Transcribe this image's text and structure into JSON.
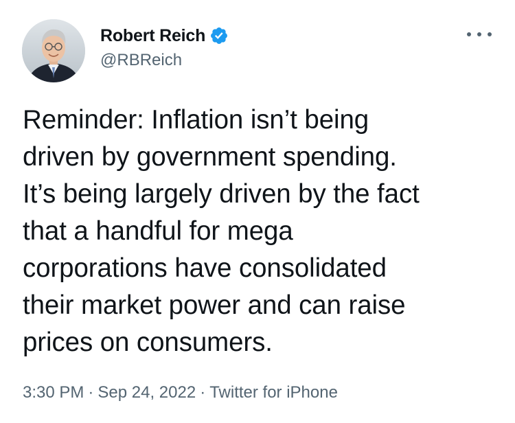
{
  "author": {
    "display_name": "Robert Reich",
    "handle": "@RBReich",
    "verified": true,
    "verified_color": "#1d9bf0"
  },
  "tweet": {
    "text_lines": [
      "Reminder: Inflation isn’t being",
      "driven by government spending.",
      "It’s being largely driven by the fact",
      "that a handful for mega",
      "corporations have consolidated",
      "their market power and can raise",
      "prices on consumers."
    ]
  },
  "meta": {
    "time": "3:30 PM",
    "separator": "·",
    "date": "Sep 24, 2022",
    "source": "Twitter for iPhone"
  },
  "icons": {
    "more": "more-options-icon",
    "verified": "verified-badge-icon"
  }
}
